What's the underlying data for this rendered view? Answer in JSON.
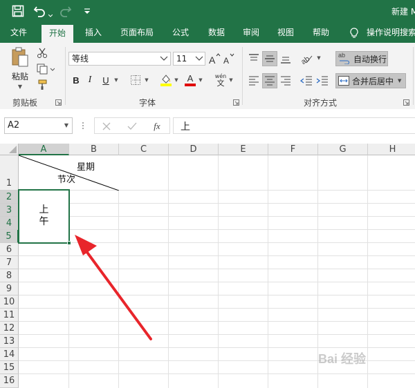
{
  "titlebar": {
    "title": "新建 M"
  },
  "tabs": [
    "文件",
    "开始",
    "插入",
    "页面布局",
    "公式",
    "数据",
    "审阅",
    "视图",
    "帮助"
  ],
  "tell_me": "操作说明搜索",
  "clipboard": {
    "paste_label": "粘贴",
    "group_label": "剪贴板"
  },
  "font": {
    "name": "等线",
    "size": "11",
    "bold": "B",
    "italic": "I",
    "underline": "U",
    "font_color_glyph": "A",
    "phonetic_glyph": "wén",
    "group_label": "字体"
  },
  "alignment": {
    "wrap_text": "自动换行",
    "merge_center": "合并后居中",
    "group_label": "对齐方式",
    "wrap_icon_text": "ab"
  },
  "formula_bar": {
    "name_box": "A2",
    "fx": "fx",
    "formula": "上"
  },
  "columns": [
    "A",
    "B",
    "C",
    "D",
    "E",
    "F",
    "G",
    "H"
  ],
  "rows": [
    "1",
    "2",
    "3",
    "4",
    "5",
    "6",
    "7",
    "8",
    "9",
    "10",
    "11",
    "12",
    "13",
    "14",
    "15",
    "16"
  ],
  "cells": {
    "b1_top": "星期",
    "b1_bottom": "节次",
    "a2_line1": "上",
    "a2_line2": "午"
  },
  "watermark": "Bai 经验",
  "colors": {
    "excel_green": "#217346",
    "arrow_red": "#e8252b",
    "selection": "#217346"
  }
}
